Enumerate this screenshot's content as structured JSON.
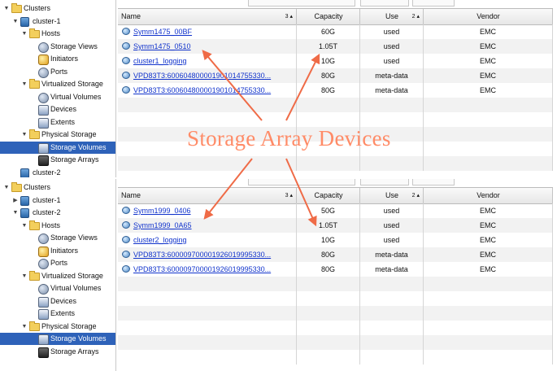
{
  "app": {
    "accent": "#2e62b9",
    "annotation_color": "#ff8b67"
  },
  "top": {
    "tree": [
      {
        "label": "Clusters",
        "indent": 0,
        "icon": "folder-icon",
        "expanded": true
      },
      {
        "label": "cluster-1",
        "indent": 1,
        "icon": "cluster-icon",
        "expanded": true
      },
      {
        "label": "Hosts",
        "indent": 2,
        "icon": "folder-icon",
        "expanded": true
      },
      {
        "label": "Storage Views",
        "indent": 3,
        "icon": "storage-view-icon"
      },
      {
        "label": "Initiators",
        "indent": 3,
        "icon": "initiator-icon"
      },
      {
        "label": "Ports",
        "indent": 3,
        "icon": "port-icon"
      },
      {
        "label": "Virtualized Storage",
        "indent": 2,
        "icon": "folder-icon",
        "expanded": true
      },
      {
        "label": "Virtual Volumes",
        "indent": 3,
        "icon": "virtual-volume-icon"
      },
      {
        "label": "Devices",
        "indent": 3,
        "icon": "device-icon"
      },
      {
        "label": "Extents",
        "indent": 3,
        "icon": "extent-icon"
      },
      {
        "label": "Physical Storage",
        "indent": 2,
        "icon": "folder-icon",
        "expanded": true
      },
      {
        "label": "Storage Volumes",
        "indent": 3,
        "icon": "storage-volume-icon",
        "selected": true
      },
      {
        "label": "Storage Arrays",
        "indent": 3,
        "icon": "storage-array-icon"
      },
      {
        "label": "cluster-2",
        "indent": 1,
        "icon": "cluster-icon",
        "partial": true
      }
    ],
    "columns": [
      {
        "label": "Name",
        "sort": "3 ▴"
      },
      {
        "label": "Capacity",
        "sort": ""
      },
      {
        "label": "Use",
        "sort": "2 ▴"
      },
      {
        "label": "Vendor",
        "sort": ""
      }
    ],
    "rows": [
      {
        "name": "Symm1475_00BF",
        "capacity": "60G",
        "use": "used",
        "vendor": "EMC"
      },
      {
        "name": "Symm1475_0510",
        "capacity": "1.05T",
        "use": "used",
        "vendor": "EMC"
      },
      {
        "name": "cluster1_logging",
        "capacity": "10G",
        "use": "used",
        "vendor": "EMC"
      },
      {
        "name": "VPD83T3:600604800001901014755330...",
        "capacity": "80G",
        "use": "meta-data",
        "vendor": "EMC"
      },
      {
        "name": "VPD83T3:600604800001901014755330...",
        "capacity": "80G",
        "use": "meta-data",
        "vendor": "EMC"
      }
    ],
    "empty_rows": 5
  },
  "bottom": {
    "tree": [
      {
        "label": "Clusters",
        "indent": 0,
        "icon": "folder-icon",
        "expanded": true
      },
      {
        "label": "cluster-1",
        "indent": 1,
        "icon": "cluster-icon",
        "expanded": false
      },
      {
        "label": "cluster-2",
        "indent": 1,
        "icon": "cluster-icon",
        "expanded": true
      },
      {
        "label": "Hosts",
        "indent": 2,
        "icon": "folder-icon",
        "expanded": true
      },
      {
        "label": "Storage Views",
        "indent": 3,
        "icon": "storage-view-icon"
      },
      {
        "label": "Initiators",
        "indent": 3,
        "icon": "initiator-icon"
      },
      {
        "label": "Ports",
        "indent": 3,
        "icon": "port-icon"
      },
      {
        "label": "Virtualized Storage",
        "indent": 2,
        "icon": "folder-icon",
        "expanded": true
      },
      {
        "label": "Virtual Volumes",
        "indent": 3,
        "icon": "virtual-volume-icon"
      },
      {
        "label": "Devices",
        "indent": 3,
        "icon": "device-icon"
      },
      {
        "label": "Extents",
        "indent": 3,
        "icon": "extent-icon"
      },
      {
        "label": "Physical Storage",
        "indent": 2,
        "icon": "folder-icon",
        "expanded": true
      },
      {
        "label": "Storage Volumes",
        "indent": 3,
        "icon": "storage-volume-icon",
        "selected": true
      },
      {
        "label": "Storage Arrays",
        "indent": 3,
        "icon": "storage-array-icon"
      }
    ],
    "columns": [
      {
        "label": "Name",
        "sort": "3 ▴"
      },
      {
        "label": "Capacity",
        "sort": ""
      },
      {
        "label": "Use",
        "sort": "2 ▴"
      },
      {
        "label": "Vendor",
        "sort": ""
      }
    ],
    "rows": [
      {
        "name": "Symm1999_0406",
        "capacity": "50G",
        "use": "used",
        "vendor": "EMC"
      },
      {
        "name": "Symm1999_0A65",
        "capacity": "1.05T",
        "use": "used",
        "vendor": "EMC"
      },
      {
        "name": "cluster2_logging",
        "capacity": "10G",
        "use": "used",
        "vendor": "EMC"
      },
      {
        "name": "VPD83T3:600009700001926019995330...",
        "capacity": "80G",
        "use": "meta-data",
        "vendor": "EMC"
      },
      {
        "name": "VPD83T3:600009700001926019995330...",
        "capacity": "80G",
        "use": "meta-data",
        "vendor": "EMC"
      }
    ],
    "empty_rows": 6
  },
  "annotation": {
    "text": "Storage Array Devices"
  }
}
